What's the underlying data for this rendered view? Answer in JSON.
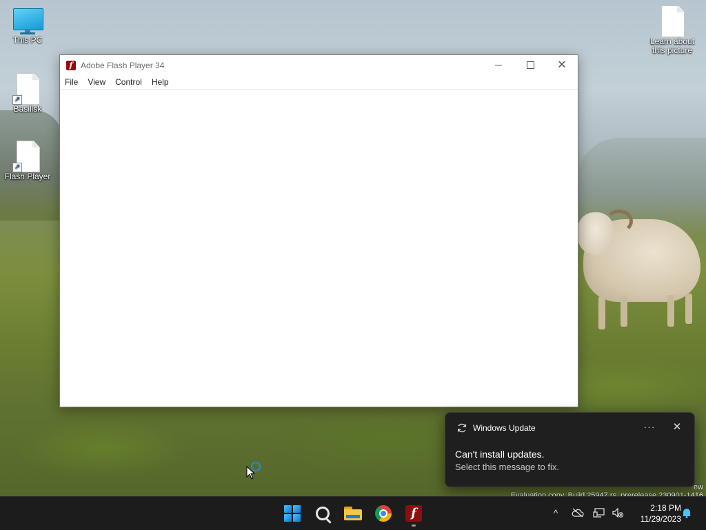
{
  "desktop": {
    "icons": [
      {
        "label": "This PC"
      },
      {
        "label": "Basilisk"
      },
      {
        "label": "Flash Player"
      },
      {
        "label": "Learn about this picture"
      }
    ],
    "watermark_line1": "ew",
    "watermark_line2": "Evaluation copy. Build 25947.rs_prerelease.230901-1416"
  },
  "window": {
    "title": "Adobe Flash Player 34",
    "menu": [
      "File",
      "View",
      "Control",
      "Help"
    ],
    "minimize_symbol": "–",
    "close_symbol": "✕"
  },
  "notification": {
    "app_name": "Windows Update",
    "more_symbol": "···",
    "close_symbol": "✕",
    "title": "Can't install updates.",
    "body": "Select this message to fix."
  },
  "taskbar": {
    "apps": [
      {
        "name": "Start",
        "icon": "windows-logo-icon"
      },
      {
        "name": "Search",
        "icon": "search-icon"
      },
      {
        "name": "File Explorer",
        "icon": "folder-icon"
      },
      {
        "name": "Google Chrome",
        "icon": "chrome-icon"
      },
      {
        "name": "Adobe Flash Player",
        "icon": "flash-icon",
        "running": true
      }
    ],
    "tray": {
      "chevron_symbol": "^",
      "time": "2:18 PM",
      "date": "11/29/2023"
    }
  },
  "colors": {
    "accent": "#0a78d4",
    "flash_red": "#8b0f0f",
    "taskbar_bg": "#1c1c1c",
    "toast_bg": "#1f1f1f"
  }
}
